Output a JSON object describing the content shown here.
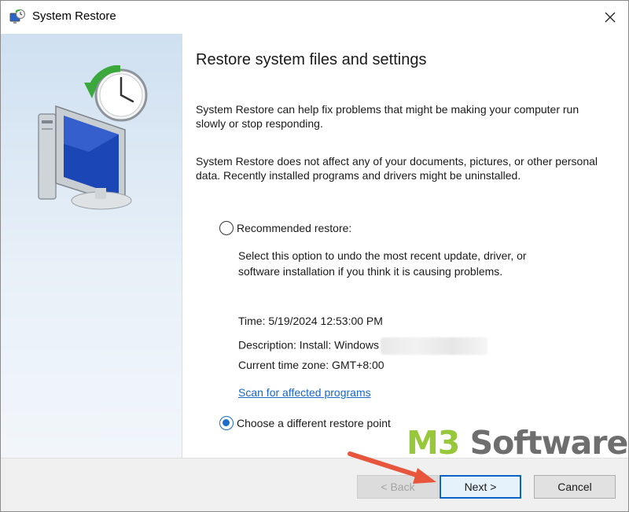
{
  "window": {
    "title": "System Restore",
    "icons": {
      "app": "system-restore-icon",
      "close": "close-icon"
    }
  },
  "main": {
    "heading": "Restore system files and settings",
    "paragraph1": "System Restore can help fix problems that might be making your computer run slowly or stop responding.",
    "paragraph2": "System Restore does not affect any of your documents, pictures, or other personal data. Recently installed programs and drivers might be uninstalled.",
    "recommended": {
      "label": "Recommended restore:",
      "selected": false,
      "description": "Select this option to undo the most recent update, driver, or software installation if you think it is causing problems.",
      "time": "Time: 5/19/2024 12:53:00 PM",
      "description_line": "Description: Install: Windows",
      "timezone": "Current time zone: GMT+8:00",
      "scan_link": "Scan for affected programs"
    },
    "different": {
      "label": "Choose a different restore point",
      "selected": true
    }
  },
  "footer": {
    "back_label": "< Back",
    "next_label": "Next >",
    "cancel_label": "Cancel"
  },
  "watermark": {
    "part1": "M3",
    "part2": " Software"
  },
  "colors": {
    "accent": "#0a64c8",
    "link": "#1a66c6",
    "watermark_green": "#96c83a",
    "watermark_gray": "#6e6e6e",
    "arrow": "#e8553d"
  }
}
